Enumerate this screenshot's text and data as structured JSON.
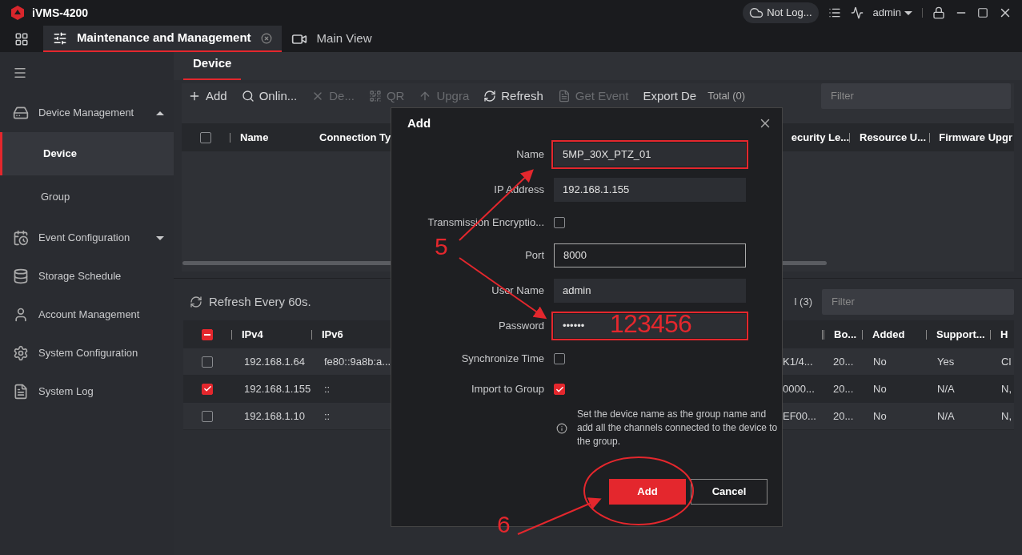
{
  "app_title": "iVMS-4200",
  "top_bar": {
    "cloud_status": "Not Log...",
    "user": "admin"
  },
  "module_tabs": [
    {
      "label": "Maintenance and Management",
      "selected": true,
      "closable": true
    },
    {
      "label": "Main View",
      "selected": false,
      "closable": false
    }
  ],
  "sidebar": {
    "items": [
      {
        "label": "Device Management",
        "kind": "group",
        "expanded": true,
        "selected": false
      },
      {
        "label": "Device",
        "kind": "child",
        "selected": true
      },
      {
        "label": "Group",
        "kind": "child",
        "selected": false
      },
      {
        "label": "Event Configuration",
        "kind": "group",
        "expanded": false,
        "selected": false
      },
      {
        "label": "Storage Schedule",
        "kind": "item",
        "selected": false
      },
      {
        "label": "Account Management",
        "kind": "item",
        "selected": false
      },
      {
        "label": "System Configuration",
        "kind": "item",
        "selected": false
      },
      {
        "label": "System Log",
        "kind": "item",
        "selected": false
      }
    ]
  },
  "page_tabs": [
    {
      "label": "Device",
      "selected": true
    }
  ],
  "toolbar": [
    {
      "label": "Add",
      "disabled": false
    },
    {
      "label": "Onlin...",
      "disabled": false
    },
    {
      "label": "De...",
      "disabled": true
    },
    {
      "label": "QR",
      "disabled": true
    },
    {
      "label": "Upgra",
      "disabled": true
    },
    {
      "label": "Refresh",
      "disabled": false
    },
    {
      "label": "Get Event",
      "disabled": true
    },
    {
      "label": "Export De",
      "disabled": false
    }
  ],
  "device_total": "Total (0)",
  "device_filter": {
    "placeholder": "Filter"
  },
  "device_table": {
    "columns": [
      "Name",
      "Connection Ty",
      "ecurity Le...",
      "Resource U...",
      "Firmware Upgr"
    ],
    "select_all": false
  },
  "online": {
    "refresh_label": "Refresh Every 60s.",
    "total": "l (3)",
    "filter": {
      "placeholder": "Filter"
    },
    "partially_selected": true,
    "columns": [
      "IPv4",
      "IPv6",
      "",
      "Bo...",
      "Added",
      "Support...",
      "H"
    ],
    "rows": [
      {
        "checked": false,
        "cells": [
          "192.168.1.64",
          "fe80::9a8b:a...",
          "K1/4...",
          "20...",
          "No",
          "Yes",
          "Cl"
        ]
      },
      {
        "checked": true,
        "cells": [
          "192.168.1.155",
          "::",
          "0000...",
          "20...",
          "No",
          "N/A",
          "N,"
        ]
      },
      {
        "checked": false,
        "cells": [
          "192.168.1.10",
          "::",
          "EF00...",
          "20...",
          "No",
          "N/A",
          "N,"
        ]
      }
    ]
  },
  "dialog": {
    "title": "Add",
    "fields": [
      {
        "label": "Name",
        "kind": "text",
        "value": "5MP_30X_PTZ_01",
        "highlighted": true,
        "focused": false
      },
      {
        "label": "IP Address",
        "kind": "text",
        "value": "192.168.1.155",
        "highlighted": false,
        "focused": false
      },
      {
        "label": "Transmission Encryptio...",
        "kind": "checkbox",
        "checked": false
      },
      {
        "label": "Port",
        "kind": "text",
        "value": "8000",
        "highlighted": false,
        "focused": true
      },
      {
        "label": "User Name",
        "kind": "text",
        "value": "admin",
        "highlighted": false,
        "focused": false
      },
      {
        "label": "Password",
        "kind": "text",
        "value": "••••••",
        "highlighted": true,
        "focused": false
      },
      {
        "label": "Synchronize Time",
        "kind": "checkbox",
        "checked": false
      },
      {
        "label": "Import to Group",
        "kind": "checkbox",
        "checked": true
      }
    ],
    "hint": "Set the device name as the group name and add all the channels connected to the device to the group.",
    "buttons": [
      {
        "label": "Add",
        "primary": true
      },
      {
        "label": "Cancel",
        "primary": false
      }
    ]
  },
  "annotations": [
    {
      "kind": "step",
      "text": "5"
    },
    {
      "kind": "note",
      "text": "123456"
    },
    {
      "kind": "step",
      "text": "6"
    }
  ]
}
